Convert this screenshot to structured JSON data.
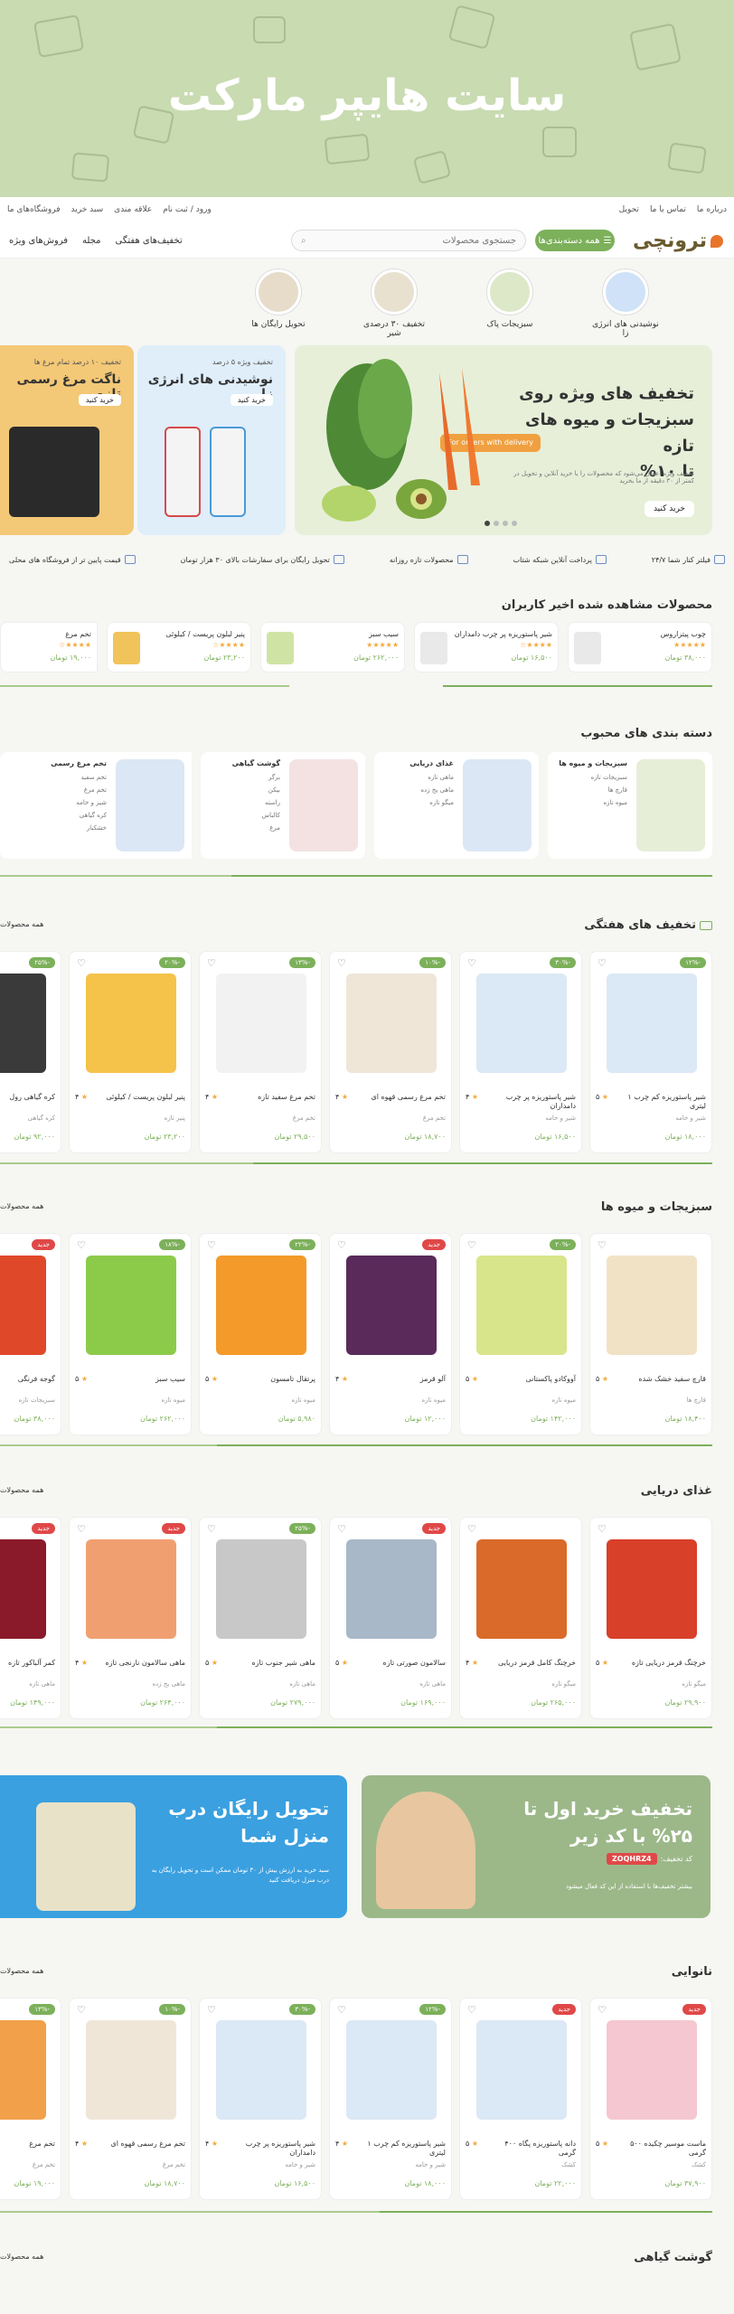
{
  "hero": {
    "title": "سایت هایپر مارکت"
  },
  "topbar": {
    "right": [
      "درباره ما",
      "تماس با ما",
      "تحویل"
    ],
    "left": [
      "ورود / ثبت نام",
      "علاقه مندی",
      "سبد خرید",
      "فروشگاه‌های ما"
    ]
  },
  "header": {
    "logo": "ترونچی",
    "categories_label": "همه دسته‌بندی‌ها",
    "search_placeholder": "جستجوی محصولات",
    "nav": [
      "فروش‌های ویژه",
      "مجله",
      "تخفیف‌های هفتگی"
    ]
  },
  "categories": [
    "نوشیدنی های انرژی زا",
    "سبزیجات پاک",
    "تخفیف ۳۰ درصدی شیر",
    "تحویل رایگان ها"
  ],
  "banner_main": {
    "title": "تخفیف های ویژه روی سبزیجات و میوه های تازه",
    "discount": "تا ۱۰%",
    "delivery": "For orders with delivery",
    "sub": "تخفیف ویژه اعمال می‌شود که محصولات را با خرید آنلاین و تحویل در کمتر از ۳۰ دقیقه از ما بخرید",
    "button": "خرید کنید"
  },
  "banner_mid": {
    "small": "تخفیف ویژه ۵ درصد",
    "title": "نوشیدنی های انرژی زا",
    "button": "خرید کنید"
  },
  "banner_small": {
    "small": "تخفیف ۱۰ درصد تمام مرغ ها",
    "title": "ناگت مرغ رسمی تازه",
    "button": "خرید کنید"
  },
  "features": [
    "فیلتر کنار شما ۲۴/۷",
    "پرداخت آنلاین شبکه شتاب",
    "محصولات تازه روزانه",
    "تحویل رایگان برای سفارشات بالای ۳۰ هزار تومان",
    "قیمت پایین تر از فروشگاه های محلی"
  ],
  "recent": {
    "title": "محصولات مشاهده شده اخیر کاربران",
    "items": [
      {
        "name": "چوب پیتزاروس",
        "price": "۳۸,۰۰۰ تومان"
      },
      {
        "name": "شیر پاستوریزه پر چرب دامداران",
        "price": "۱۶,۵۰۰ تومان"
      },
      {
        "name": "سیب سبز",
        "price": "۲۶۲,۰۰۰ تومان"
      },
      {
        "name": "پنیر لبلون پریست / کیلوئی",
        "price": "۲۳,۲۰۰ تومان"
      },
      {
        "name": "تخم مرغ",
        "price": "۱۹,۰۰۰ تومان"
      }
    ]
  },
  "popular": {
    "title": "دسته بندی های محبوب",
    "cards": [
      {
        "title": "سبزیجات و میوه ها",
        "items": [
          "سبزیجات تازه",
          "قارچ ها",
          "میوه تازه"
        ]
      },
      {
        "title": "غذای دریایی",
        "items": [
          "ماهی تازه",
          "ماهی یخ زده",
          "میگو تازه"
        ]
      },
      {
        "title": "گوشت گیاهی",
        "items": [
          "برگر",
          "بیکن",
          "راسته",
          "کالباس",
          "مرغ"
        ]
      },
      {
        "title": "تخم مرغ رسمی",
        "items": [
          "تخم سفید",
          "تخم مرغ",
          "شیر و خامه",
          "کره گیاهی",
          "خشکبار"
        ]
      }
    ]
  },
  "all_link": "همه محصولات",
  "weekly": {
    "title": "تخفیف های هفتگی",
    "products": [
      {
        "name": "شیر پاستوریزه کم چرب ۱ لیتری",
        "sub": "شیر و خامه",
        "price": "۱۸,۰۰۰ تومان",
        "rating": "۵",
        "badge": "-۱۲%"
      },
      {
        "name": "شیر پاستوریزه پر چرب دامداران",
        "sub": "شیر و خامه",
        "price": "۱۶,۵۰۰ تومان",
        "rating": "۴",
        "badge": "-۳۰%"
      },
      {
        "name": "تخم مرغ رسمی قهوه ای",
        "sub": "تخم مرغ",
        "price": "۱۸,۷۰۰ تومان",
        "rating": "۴",
        "badge": "-۱۰%"
      },
      {
        "name": "تخم مرغ سفید تازه",
        "sub": "تخم مرغ",
        "price": "۲۹,۵۰۰ تومان",
        "rating": "۴",
        "badge": "-۱۳%"
      },
      {
        "name": "پنیر لبلون پریست / کیلوئی",
        "sub": "پنیر تازه",
        "price": "۲۳,۲۰۰ تومان",
        "rating": "۴",
        "badge": "-۲۰%"
      },
      {
        "name": "کره گیاهی رول",
        "sub": "کره گیاهی",
        "price": "۹۲,۰۰۰ تومان",
        "rating": "۵",
        "badge": "-۲۵%"
      }
    ]
  },
  "veg": {
    "title": "سبزیجات و میوه ها",
    "products": [
      {
        "name": "قارچ سفید خشک شده",
        "sub": "قارچ ها",
        "price": "۱۸,۴۰۰ تومان",
        "rating": "۵",
        "badge": ""
      },
      {
        "name": "آووکادو پاکستانی",
        "sub": "میوه تازه",
        "price": "۱۴۲,۰۰۰ تومان",
        "rating": "۵",
        "badge": "-۲۰%"
      },
      {
        "name": "آلو قرمز",
        "sub": "میوه تازه",
        "price": "۱۲,۰۰۰ تومان",
        "rating": "۴",
        "badge": "جدید"
      },
      {
        "name": "پرتقال تامسون",
        "sub": "میوه تازه",
        "price": "۵,۹۸۰ تومان",
        "rating": "۵",
        "badge": "-۲۲%"
      },
      {
        "name": "سیب سبز",
        "sub": "میوه تازه",
        "price": "۲۶۲,۰۰۰ تومان",
        "rating": "۵",
        "badge": "-۱۸%"
      },
      {
        "name": "گوجه فرنگی",
        "sub": "سبزیجات تازه",
        "price": "۳۸,۰۰۰ تومان",
        "rating": "۵",
        "badge": "جدید"
      }
    ]
  },
  "seafood": {
    "title": "غذای دریایی",
    "products": [
      {
        "name": "خرچنگ قرمز دریایی تازه",
        "sub": "میگو تازه",
        "price": "۲۹,۹۰۰ تومان",
        "rating": "۵",
        "badge": ""
      },
      {
        "name": "خرچنگ کامل قرمز دریایی",
        "sub": "میگو تازه",
        "price": "۲۶۵,۰۰۰ تومان",
        "rating": "۴",
        "badge": ""
      },
      {
        "name": "سالامون صورتی تازه",
        "sub": "ماهی تازه",
        "price": "۱۶۹,۰۰۰ تومان",
        "rating": "۵",
        "badge": "جدید"
      },
      {
        "name": "ماهی شیر جنوب تازه",
        "sub": "ماهی تازه",
        "price": "۲۷۹,۰۰۰ تومان",
        "rating": "۵",
        "badge": "-۲۵%"
      },
      {
        "name": "ماهی سالامون نارنجی تازه",
        "sub": "ماهی یخ زده",
        "price": "۲۶۴,۰۰۰ تومان",
        "rating": "۴",
        "badge": "جدید"
      },
      {
        "name": "کمر آلباکور تازه",
        "sub": "ماهی تازه",
        "price": "۱۴۹,۰۰۰ تومان",
        "rating": "۵",
        "badge": "جدید"
      }
    ]
  },
  "promo_green": {
    "title": "تخفیف خرید اول تا ۲۵% با کد زیر",
    "code_label": "کد تخفیف:",
    "code": "ZOQHRZ4",
    "sub": "بیشتر تخفیف‌ها با استفاده از این کد فعال میشود"
  },
  "promo_blue": {
    "title": "تحویل رایگان درب منزل شما",
    "sub": "سبد خرید به ارزش بیش از ۳۰ تومان ممکن است و تحویل رایگان به درب منزل دریافت کنید"
  },
  "bakery": {
    "title": "نانوایی",
    "products": [
      {
        "name": "ماست موسیر چکیده ۵۰۰ گرمی",
        "sub": "کشک",
        "price": "۳۷,۹۰۰ تومان",
        "rating": "۵",
        "badge": "جدید"
      },
      {
        "name": "دانه پاستوریزه پگاه ۴۰۰ گرمی",
        "sub": "کشک",
        "price": "۲۲,۰۰۰ تومان",
        "rating": "۵",
        "badge": "جدید"
      },
      {
        "name": "شیر پاستوریزه کم چرب ۱ لیتری",
        "sub": "شیر و خامه",
        "price": "۱۸,۰۰۰ تومان",
        "rating": "۴",
        "badge": "-۱۲%"
      },
      {
        "name": "شیر پاستوریزه پر چرب دامداران",
        "sub": "شیر و خامه",
        "price": "۱۶,۵۰۰ تومان",
        "rating": "۴",
        "badge": "-۳۰%"
      },
      {
        "name": "تخم مرغ رسمی قهوه ای",
        "sub": "تخم مرغ",
        "price": "۱۸,۷۰۰ تومان",
        "rating": "۴",
        "badge": "-۱۰%"
      },
      {
        "name": "تخم مرغ",
        "sub": "تخم مرغ",
        "price": "۱۹,۰۰۰ تومان",
        "rating": "۴",
        "badge": "-۱۳%"
      }
    ]
  },
  "veg_meat": {
    "title": "گوشت گیاهی"
  },
  "colors": {
    "accent": "#7cb05a",
    "sale": "#e04848",
    "hero": "#c9dbb1",
    "promo_green": "#9cb889",
    "promo_blue": "#3aa0e0"
  }
}
